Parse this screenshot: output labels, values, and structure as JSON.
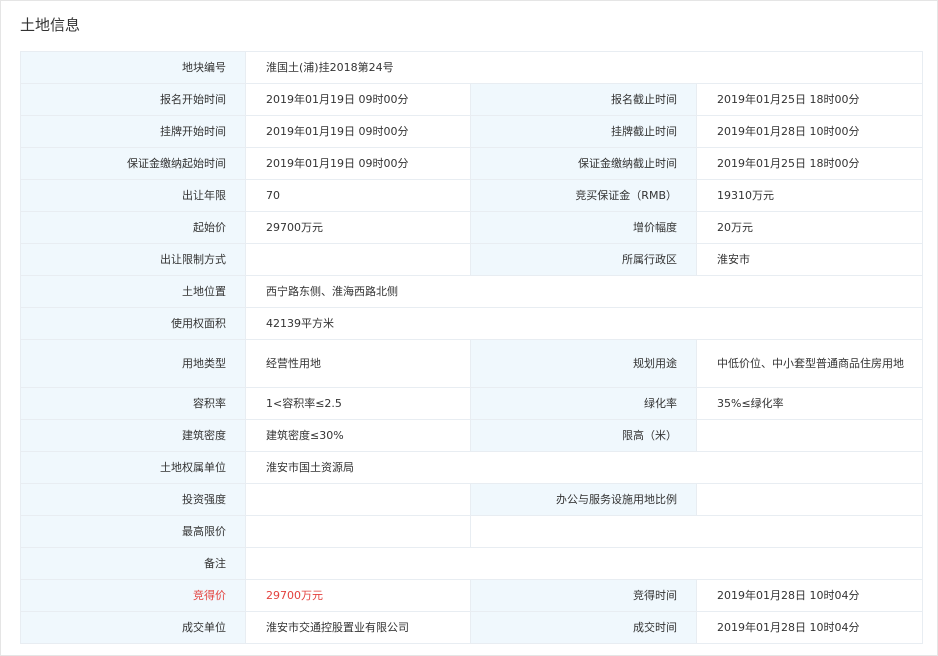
{
  "panel": {
    "title": "土地信息"
  },
  "colors": {
    "label_bg": "#f0f8fd",
    "border": "#e8edf2",
    "highlight": "#e3413e"
  },
  "rows": {
    "parcel_no": {
      "label": "地块编号",
      "value": "淮国土(浦)挂2018第24号"
    },
    "reg_start": {
      "label": "报名开始时间",
      "value": "2019年01月19日 09时00分"
    },
    "reg_end": {
      "label": "报名截止时间",
      "value": "2019年01月25日 18时00分"
    },
    "list_start": {
      "label": "挂牌开始时间",
      "value": "2019年01月19日 09时00分"
    },
    "list_end": {
      "label": "挂牌截止时间",
      "value": "2019年01月28日 10时00分"
    },
    "deposit_start": {
      "label": "保证金缴纳起始时间",
      "value": "2019年01月19日 09时00分"
    },
    "deposit_end": {
      "label": "保证金缴纳截止时间",
      "value": "2019年01月25日 18时00分"
    },
    "term": {
      "label": "出让年限",
      "value": "70"
    },
    "deposit": {
      "label": "竞买保证金（RMB）",
      "value": "19310万元"
    },
    "start_price": {
      "label": "起始价",
      "value": "29700万元"
    },
    "increment": {
      "label": "增价幅度",
      "value": "20万元"
    },
    "restriction": {
      "label": "出让限制方式",
      "value": ""
    },
    "district": {
      "label": "所属行政区",
      "value": "淮安市"
    },
    "location": {
      "label": "土地位置",
      "value": "西宁路东侧、淮海西路北侧"
    },
    "area": {
      "label": "使用权面积",
      "value": "42139平方米"
    },
    "land_use": {
      "label": "用地类型",
      "value": "经营性用地"
    },
    "planned_use": {
      "label": "规划用途",
      "value": "中低价位、中小套型普通商品住房用地"
    },
    "far": {
      "label": "容积率",
      "value": "1<容积率≤2.5"
    },
    "green": {
      "label": "绿化率",
      "value": "35%≤绿化率"
    },
    "density": {
      "label": "建筑密度",
      "value": "建筑密度≤30%"
    },
    "height": {
      "label": "限高（米）",
      "value": ""
    },
    "owner": {
      "label": "土地权属单位",
      "value": "淮安市国土资源局"
    },
    "investment": {
      "label": "投资强度",
      "value": ""
    },
    "office_ratio": {
      "label": "办公与服务设施用地比例",
      "value": ""
    },
    "max_price": {
      "label": "最高限价",
      "value": ""
    },
    "remark": {
      "label": "备注",
      "value": ""
    },
    "deal_price": {
      "label": "竞得价",
      "value": "29700万元"
    },
    "deal_time": {
      "label": "竞得时间",
      "value": "2019年01月28日 10时04分"
    },
    "buyer": {
      "label": "成交单位",
      "value": "淮安市交通控股置业有限公司"
    },
    "close_time": {
      "label": "成交时间",
      "value": "2019年01月28日 10时04分"
    }
  }
}
